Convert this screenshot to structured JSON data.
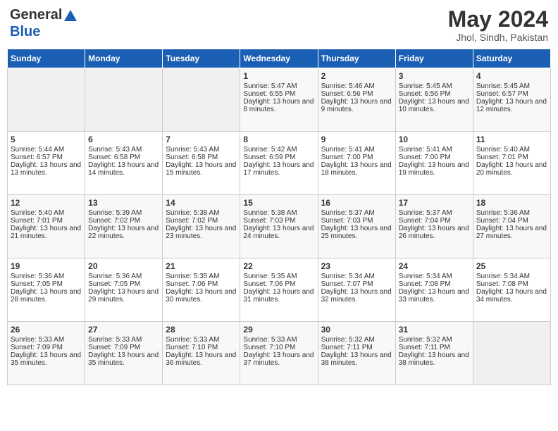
{
  "header": {
    "logo_general": "General",
    "logo_blue": "Blue",
    "month_year": "May 2024",
    "location": "Jhol, Sindh, Pakistan"
  },
  "days_of_week": [
    "Sunday",
    "Monday",
    "Tuesday",
    "Wednesday",
    "Thursday",
    "Friday",
    "Saturday"
  ],
  "weeks": [
    [
      {
        "day": "",
        "empty": true
      },
      {
        "day": "",
        "empty": true
      },
      {
        "day": "",
        "empty": true
      },
      {
        "day": "1",
        "sunrise": "5:47 AM",
        "sunset": "6:55 PM",
        "daylight": "13 hours and 8 minutes."
      },
      {
        "day": "2",
        "sunrise": "5:46 AM",
        "sunset": "6:56 PM",
        "daylight": "13 hours and 9 minutes."
      },
      {
        "day": "3",
        "sunrise": "5:45 AM",
        "sunset": "6:56 PM",
        "daylight": "13 hours and 10 minutes."
      },
      {
        "day": "4",
        "sunrise": "5:45 AM",
        "sunset": "6:57 PM",
        "daylight": "13 hours and 12 minutes."
      }
    ],
    [
      {
        "day": "5",
        "sunrise": "5:44 AM",
        "sunset": "6:57 PM",
        "daylight": "13 hours and 13 minutes."
      },
      {
        "day": "6",
        "sunrise": "5:43 AM",
        "sunset": "6:58 PM",
        "daylight": "13 hours and 14 minutes."
      },
      {
        "day": "7",
        "sunrise": "5:43 AM",
        "sunset": "6:58 PM",
        "daylight": "13 hours and 15 minutes."
      },
      {
        "day": "8",
        "sunrise": "5:42 AM",
        "sunset": "6:59 PM",
        "daylight": "13 hours and 17 minutes."
      },
      {
        "day": "9",
        "sunrise": "5:41 AM",
        "sunset": "7:00 PM",
        "daylight": "13 hours and 18 minutes."
      },
      {
        "day": "10",
        "sunrise": "5:41 AM",
        "sunset": "7:00 PM",
        "daylight": "13 hours and 19 minutes."
      },
      {
        "day": "11",
        "sunrise": "5:40 AM",
        "sunset": "7:01 PM",
        "daylight": "13 hours and 20 minutes."
      }
    ],
    [
      {
        "day": "12",
        "sunrise": "5:40 AM",
        "sunset": "7:01 PM",
        "daylight": "13 hours and 21 minutes."
      },
      {
        "day": "13",
        "sunrise": "5:39 AM",
        "sunset": "7:02 PM",
        "daylight": "13 hours and 22 minutes."
      },
      {
        "day": "14",
        "sunrise": "5:38 AM",
        "sunset": "7:02 PM",
        "daylight": "13 hours and 23 minutes."
      },
      {
        "day": "15",
        "sunrise": "5:38 AM",
        "sunset": "7:03 PM",
        "daylight": "13 hours and 24 minutes."
      },
      {
        "day": "16",
        "sunrise": "5:37 AM",
        "sunset": "7:03 PM",
        "daylight": "13 hours and 25 minutes."
      },
      {
        "day": "17",
        "sunrise": "5:37 AM",
        "sunset": "7:04 PM",
        "daylight": "13 hours and 26 minutes."
      },
      {
        "day": "18",
        "sunrise": "5:36 AM",
        "sunset": "7:04 PM",
        "daylight": "13 hours and 27 minutes."
      }
    ],
    [
      {
        "day": "19",
        "sunrise": "5:36 AM",
        "sunset": "7:05 PM",
        "daylight": "13 hours and 28 minutes."
      },
      {
        "day": "20",
        "sunrise": "5:36 AM",
        "sunset": "7:05 PM",
        "daylight": "13 hours and 29 minutes."
      },
      {
        "day": "21",
        "sunrise": "5:35 AM",
        "sunset": "7:06 PM",
        "daylight": "13 hours and 30 minutes."
      },
      {
        "day": "22",
        "sunrise": "5:35 AM",
        "sunset": "7:06 PM",
        "daylight": "13 hours and 31 minutes."
      },
      {
        "day": "23",
        "sunrise": "5:34 AM",
        "sunset": "7:07 PM",
        "daylight": "13 hours and 32 minutes."
      },
      {
        "day": "24",
        "sunrise": "5:34 AM",
        "sunset": "7:08 PM",
        "daylight": "13 hours and 33 minutes."
      },
      {
        "day": "25",
        "sunrise": "5:34 AM",
        "sunset": "7:08 PM",
        "daylight": "13 hours and 34 minutes."
      }
    ],
    [
      {
        "day": "26",
        "sunrise": "5:33 AM",
        "sunset": "7:09 PM",
        "daylight": "13 hours and 35 minutes."
      },
      {
        "day": "27",
        "sunrise": "5:33 AM",
        "sunset": "7:09 PM",
        "daylight": "13 hours and 35 minutes."
      },
      {
        "day": "28",
        "sunrise": "5:33 AM",
        "sunset": "7:10 PM",
        "daylight": "13 hours and 36 minutes."
      },
      {
        "day": "29",
        "sunrise": "5:33 AM",
        "sunset": "7:10 PM",
        "daylight": "13 hours and 37 minutes."
      },
      {
        "day": "30",
        "sunrise": "5:32 AM",
        "sunset": "7:11 PM",
        "daylight": "13 hours and 38 minutes."
      },
      {
        "day": "31",
        "sunrise": "5:32 AM",
        "sunset": "7:11 PM",
        "daylight": "13 hours and 38 minutes."
      },
      {
        "day": "",
        "empty": true
      }
    ]
  ],
  "labels": {
    "sunrise_prefix": "Sunrise: ",
    "sunset_prefix": "Sunset: ",
    "daylight_prefix": "Daylight: "
  }
}
